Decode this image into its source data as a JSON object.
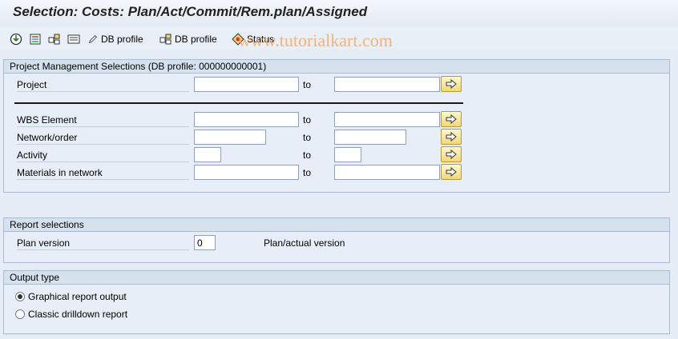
{
  "title": "Selection: Costs: Plan/Act/Commit/Rem.plan/Assigned",
  "toolbar": {
    "execute_icon": "execute-icon",
    "db_profile_1": "DB profile",
    "db_profile_2": "DB profile",
    "status": "Status"
  },
  "watermark": "www.tutorialkart.com",
  "project_group": {
    "header": "Project Management Selections (DB profile: 000000000001)",
    "rows": [
      {
        "label": "Project",
        "to": "to",
        "from_value": "",
        "to_value": ""
      },
      {
        "label": "WBS Element",
        "to": "to",
        "from_value": "",
        "to_value": ""
      },
      {
        "label": "Network/order",
        "to": "to",
        "from_value": "",
        "to_value": ""
      },
      {
        "label": "Activity",
        "to": "to",
        "from_value": "",
        "to_value": ""
      },
      {
        "label": "Materials in network",
        "to": "to",
        "from_value": "",
        "to_value": ""
      }
    ]
  },
  "report_group": {
    "header": "Report selections",
    "plan_version_label": "Plan version",
    "plan_version_value": "0",
    "plan_version_desc": "Plan/actual version"
  },
  "output_group": {
    "header": "Output type",
    "options": [
      {
        "label": "Graphical report output",
        "selected": true
      },
      {
        "label": "Classic drilldown report",
        "selected": false
      }
    ]
  },
  "colors": {
    "background": "#e5ecf5",
    "group_border": "#a6bbd3",
    "multi_button": "#f2d779",
    "watermark": "#f3a462"
  }
}
